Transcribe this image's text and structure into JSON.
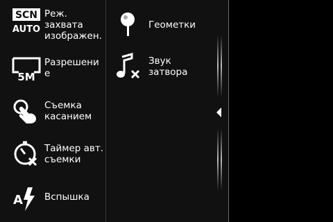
{
  "left_column": [
    {
      "label": "Реж.\nзахвата\nизображен.",
      "icon": "scene-auto-icon",
      "icon_text_top": "SCN",
      "icon_text_bottom": "AUTO"
    },
    {
      "label": "Разрешени\nе",
      "icon": "resolution-5m-icon",
      "icon_text": "5M"
    },
    {
      "label": "Съемка\nкасанием",
      "icon": "touch-shot-icon"
    },
    {
      "label": "Таймер авт.\nсъемки",
      "icon": "self-timer-off-icon"
    },
    {
      "label": "Вспышка",
      "icon": "flash-auto-icon",
      "icon_text": "A"
    }
  ],
  "right_column": [
    {
      "label": "Геометки",
      "icon": "geotag-pin-icon"
    },
    {
      "label": "Звук\nзатвора",
      "icon": "shutter-sound-off-icon"
    }
  ],
  "collapse_handle": {
    "icon": "collapse-arrow-left-icon"
  }
}
